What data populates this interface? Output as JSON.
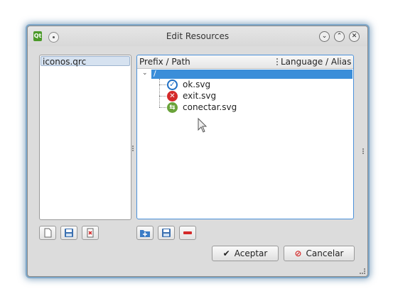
{
  "window": {
    "title": "Edit Resources"
  },
  "files": {
    "items": [
      "iconos.qrc"
    ]
  },
  "tree": {
    "headers": {
      "prefix_path": "Prefix / Path",
      "language_alias": "Language / Alias"
    },
    "root_prefix": "/",
    "entries": [
      {
        "name": "ok.svg",
        "icon": "ok-check-icon"
      },
      {
        "name": "exit.svg",
        "icon": "exit-x-icon"
      },
      {
        "name": "conectar.svg",
        "icon": "connect-icon"
      }
    ]
  },
  "buttons": {
    "accept": "Aceptar",
    "cancel": "Cancelar"
  },
  "colors": {
    "accent": "#3b8ed9",
    "ok": "#1f6fc4",
    "exit": "#d42a2a",
    "connect": "#6aa33a"
  }
}
